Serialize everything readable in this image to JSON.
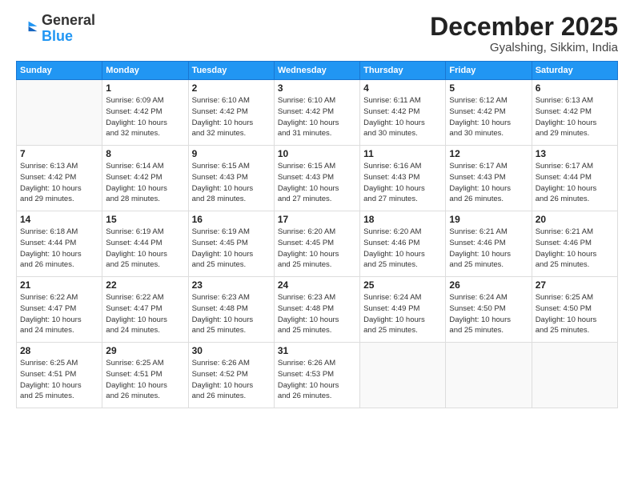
{
  "logo": {
    "general": "General",
    "blue": "Blue"
  },
  "header": {
    "month": "December 2025",
    "location": "Gyalshing, Sikkim, India"
  },
  "weekdays": [
    "Sunday",
    "Monday",
    "Tuesday",
    "Wednesday",
    "Thursday",
    "Friday",
    "Saturday"
  ],
  "weeks": [
    [
      {
        "day": "",
        "empty": true
      },
      {
        "day": "1",
        "sunrise": "6:09 AM",
        "sunset": "4:42 PM",
        "daylight": "10 hours and 32 minutes."
      },
      {
        "day": "2",
        "sunrise": "6:10 AM",
        "sunset": "4:42 PM",
        "daylight": "10 hours and 32 minutes."
      },
      {
        "day": "3",
        "sunrise": "6:10 AM",
        "sunset": "4:42 PM",
        "daylight": "10 hours and 31 minutes."
      },
      {
        "day": "4",
        "sunrise": "6:11 AM",
        "sunset": "4:42 PM",
        "daylight": "10 hours and 30 minutes."
      },
      {
        "day": "5",
        "sunrise": "6:12 AM",
        "sunset": "4:42 PM",
        "daylight": "10 hours and 30 minutes."
      },
      {
        "day": "6",
        "sunrise": "6:13 AM",
        "sunset": "4:42 PM",
        "daylight": "10 hours and 29 minutes."
      }
    ],
    [
      {
        "day": "7",
        "sunrise": "6:13 AM",
        "sunset": "4:42 PM",
        "daylight": "10 hours and 29 minutes."
      },
      {
        "day": "8",
        "sunrise": "6:14 AM",
        "sunset": "4:42 PM",
        "daylight": "10 hours and 28 minutes."
      },
      {
        "day": "9",
        "sunrise": "6:15 AM",
        "sunset": "4:43 PM",
        "daylight": "10 hours and 28 minutes."
      },
      {
        "day": "10",
        "sunrise": "6:15 AM",
        "sunset": "4:43 PM",
        "daylight": "10 hours and 27 minutes."
      },
      {
        "day": "11",
        "sunrise": "6:16 AM",
        "sunset": "4:43 PM",
        "daylight": "10 hours and 27 minutes."
      },
      {
        "day": "12",
        "sunrise": "6:17 AM",
        "sunset": "4:43 PM",
        "daylight": "10 hours and 26 minutes."
      },
      {
        "day": "13",
        "sunrise": "6:17 AM",
        "sunset": "4:44 PM",
        "daylight": "10 hours and 26 minutes."
      }
    ],
    [
      {
        "day": "14",
        "sunrise": "6:18 AM",
        "sunset": "4:44 PM",
        "daylight": "10 hours and 26 minutes."
      },
      {
        "day": "15",
        "sunrise": "6:19 AM",
        "sunset": "4:44 PM",
        "daylight": "10 hours and 25 minutes."
      },
      {
        "day": "16",
        "sunrise": "6:19 AM",
        "sunset": "4:45 PM",
        "daylight": "10 hours and 25 minutes."
      },
      {
        "day": "17",
        "sunrise": "6:20 AM",
        "sunset": "4:45 PM",
        "daylight": "10 hours and 25 minutes."
      },
      {
        "day": "18",
        "sunrise": "6:20 AM",
        "sunset": "4:46 PM",
        "daylight": "10 hours and 25 minutes."
      },
      {
        "day": "19",
        "sunrise": "6:21 AM",
        "sunset": "4:46 PM",
        "daylight": "10 hours and 25 minutes."
      },
      {
        "day": "20",
        "sunrise": "6:21 AM",
        "sunset": "4:46 PM",
        "daylight": "10 hours and 25 minutes."
      }
    ],
    [
      {
        "day": "21",
        "sunrise": "6:22 AM",
        "sunset": "4:47 PM",
        "daylight": "10 hours and 24 minutes."
      },
      {
        "day": "22",
        "sunrise": "6:22 AM",
        "sunset": "4:47 PM",
        "daylight": "10 hours and 24 minutes."
      },
      {
        "day": "23",
        "sunrise": "6:23 AM",
        "sunset": "4:48 PM",
        "daylight": "10 hours and 25 minutes."
      },
      {
        "day": "24",
        "sunrise": "6:23 AM",
        "sunset": "4:48 PM",
        "daylight": "10 hours and 25 minutes."
      },
      {
        "day": "25",
        "sunrise": "6:24 AM",
        "sunset": "4:49 PM",
        "daylight": "10 hours and 25 minutes."
      },
      {
        "day": "26",
        "sunrise": "6:24 AM",
        "sunset": "4:50 PM",
        "daylight": "10 hours and 25 minutes."
      },
      {
        "day": "27",
        "sunrise": "6:25 AM",
        "sunset": "4:50 PM",
        "daylight": "10 hours and 25 minutes."
      }
    ],
    [
      {
        "day": "28",
        "sunrise": "6:25 AM",
        "sunset": "4:51 PM",
        "daylight": "10 hours and 25 minutes."
      },
      {
        "day": "29",
        "sunrise": "6:25 AM",
        "sunset": "4:51 PM",
        "daylight": "10 hours and 26 minutes."
      },
      {
        "day": "30",
        "sunrise": "6:26 AM",
        "sunset": "4:52 PM",
        "daylight": "10 hours and 26 minutes."
      },
      {
        "day": "31",
        "sunrise": "6:26 AM",
        "sunset": "4:53 PM",
        "daylight": "10 hours and 26 minutes."
      },
      {
        "day": "",
        "empty": true
      },
      {
        "day": "",
        "empty": true
      },
      {
        "day": "",
        "empty": true
      }
    ]
  ],
  "labels": {
    "sunrise": "Sunrise:",
    "sunset": "Sunset:",
    "daylight": "Daylight:"
  }
}
